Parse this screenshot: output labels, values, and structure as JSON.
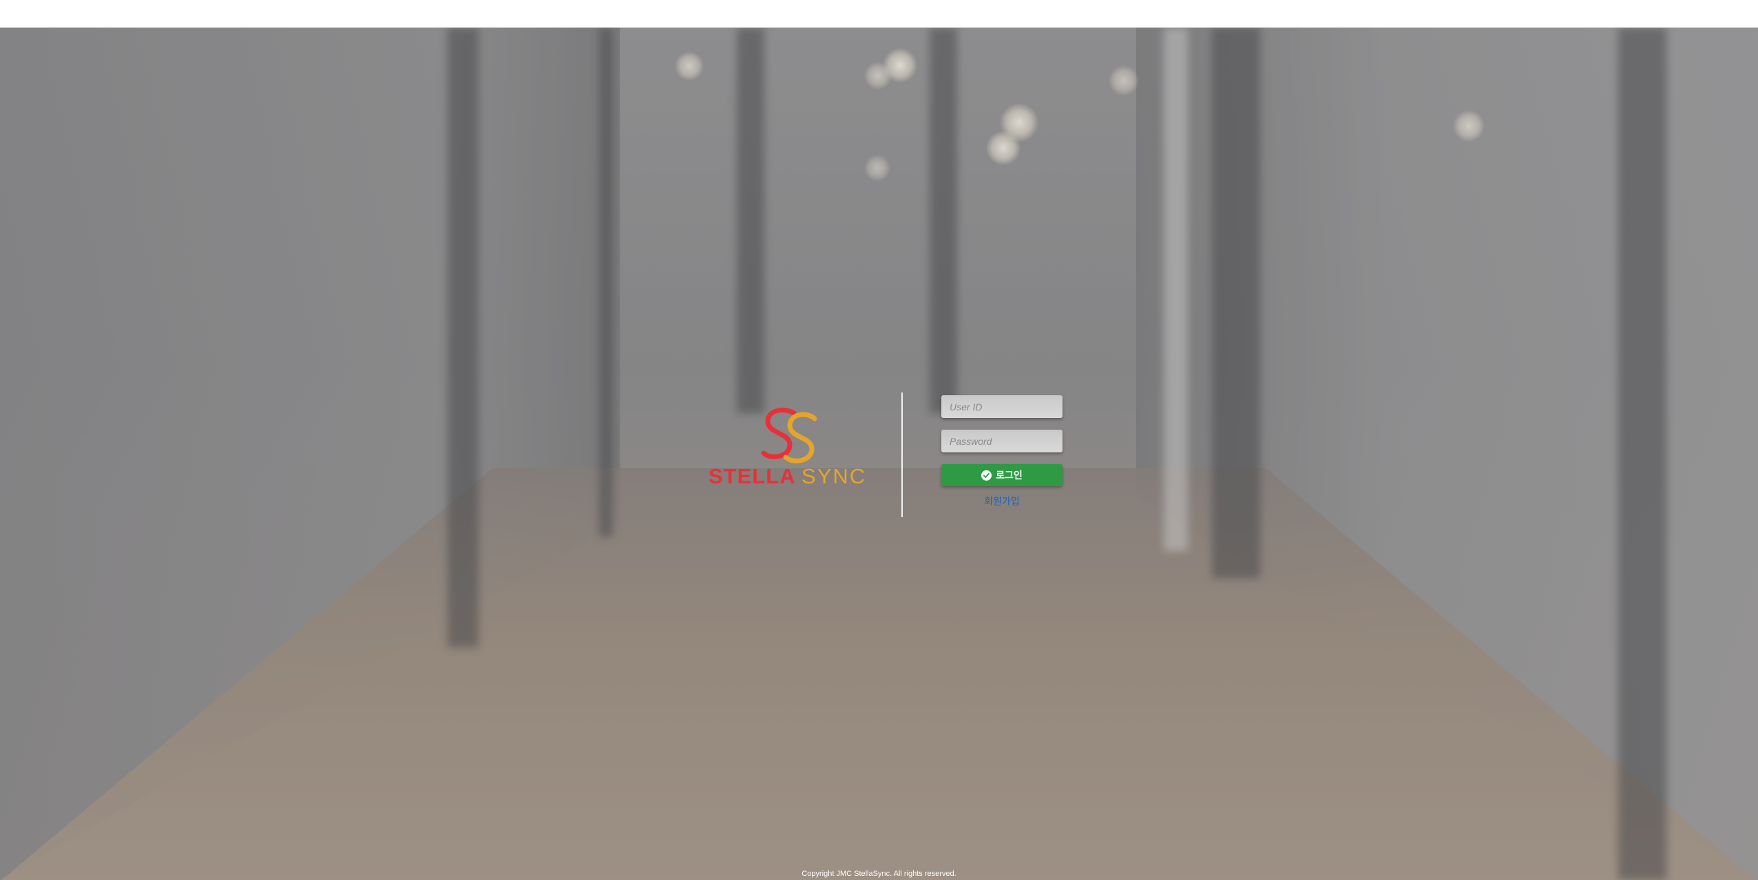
{
  "colors": {
    "accent_red": "#e8303a",
    "accent_yellow": "#e6a52a",
    "login_button": "#2e9a44",
    "signup_link": "#1b5fbf"
  },
  "logo": {
    "text_part1": "STELLA",
    "text_part2": "SYNC",
    "icon": "stella-sync-logo-icon"
  },
  "form": {
    "user_id_placeholder": "User ID",
    "user_id_value": "",
    "password_placeholder": "Password",
    "password_value": "",
    "login_label": "로그인",
    "login_icon": "check-circle-icon",
    "signup_label": "회원가입"
  },
  "footer": {
    "copyright": "Copyright JMC StellaSync. All rights reserved."
  }
}
